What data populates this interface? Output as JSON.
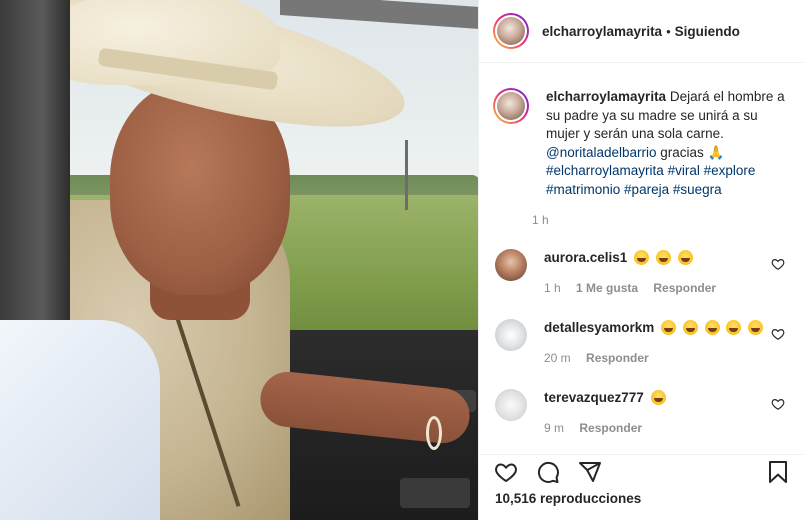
{
  "post": {
    "username": "elcharroylamayrita",
    "separator": "•",
    "follow_status": "Siguiendo"
  },
  "caption": {
    "username": "elcharroylamayrita",
    "text": "Dejará el hombre a su padre ya su madre se unirá a su mujer y serán una sola carne.",
    "mention": "@noritaladelbarrio",
    "thanks": "gracias 🙏",
    "hashtags": [
      "#elcharroylamayrita",
      "#viral",
      "#explore",
      "#matrimonio",
      "#pareja",
      "#suegra"
    ],
    "time": "1 h"
  },
  "comments": [
    {
      "username": "aurora.celis1",
      "emoji_count": 3,
      "time": "1 h",
      "likes": "1 Me gusta",
      "reply": "Responder"
    },
    {
      "username": "detallesyamorkm",
      "emoji_count": 5,
      "time": "20 m",
      "likes": "",
      "reply": "Responder"
    },
    {
      "username": "terevazquez777",
      "emoji_count": 1,
      "time": "9 m",
      "likes": "",
      "reply": "Responder"
    }
  ],
  "footer": {
    "views": "10,516 reproducciones"
  },
  "icons": {
    "like": "heart-icon",
    "comment": "comment-icon",
    "share": "share-icon",
    "save": "bookmark-icon"
  }
}
